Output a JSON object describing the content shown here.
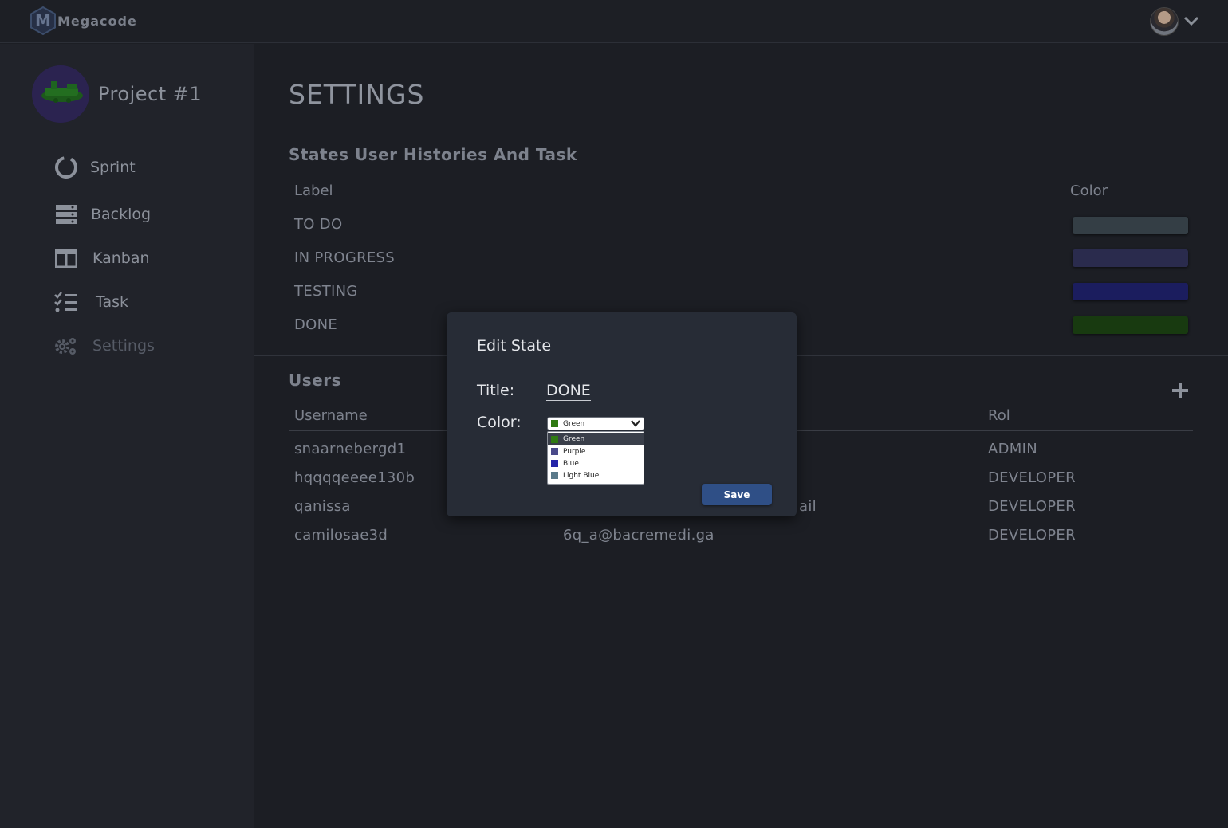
{
  "header": {
    "logo_letter": "M",
    "app_name": "Megacode"
  },
  "sidebar": {
    "project_name": "Project #1",
    "items": [
      {
        "label": "Sprint",
        "icon": "sprint-icon"
      },
      {
        "label": "Backlog",
        "icon": "backlog-icon"
      },
      {
        "label": "Kanban",
        "icon": "kanban-icon"
      },
      {
        "label": "Task",
        "icon": "task-icon"
      },
      {
        "label": "Settings",
        "icon": "settings-icon"
      }
    ],
    "active": "Settings"
  },
  "main": {
    "title": "SETTINGS",
    "states": {
      "section_title": "States User Histories And Task",
      "col_label": "Label",
      "col_color": "Color",
      "rows": [
        {
          "label": "TO DO",
          "color": "#343e45"
        },
        {
          "label": "IN PROGRESS",
          "color": "#2a2b4d"
        },
        {
          "label": "TESTING",
          "color": "#1b1d5e"
        },
        {
          "label": "DONE",
          "color": "#183a10"
        }
      ]
    },
    "users": {
      "section_title": "Users",
      "col_username": "Username",
      "col_rol": "Rol",
      "rows": [
        {
          "username": "snaarnebergd1",
          "email": "",
          "rol": "ADMIN"
        },
        {
          "username": "hqqqqeeee130b",
          "email": "",
          "rol": "DEVELOPER"
        },
        {
          "username": "qanissa",
          "email": "ail",
          "rol": "DEVELOPER"
        },
        {
          "username": "camilosae3d",
          "email": "6q_a@bacremedi.ga",
          "rol": "DEVELOPER"
        }
      ]
    }
  },
  "modal": {
    "title": "Edit State",
    "title_label": "Title:",
    "title_value": "DONE",
    "color_label": "Color:",
    "selected": "Green",
    "selected_color": "#2f7a12",
    "options": [
      {
        "label": "Green",
        "color": "#2f7a12"
      },
      {
        "label": "Purple",
        "color": "#4a4a8a"
      },
      {
        "label": "Blue",
        "color": "#2424a8"
      },
      {
        "label": "Light Blue",
        "color": "#5a7a8a"
      }
    ],
    "save_label": "Save"
  }
}
